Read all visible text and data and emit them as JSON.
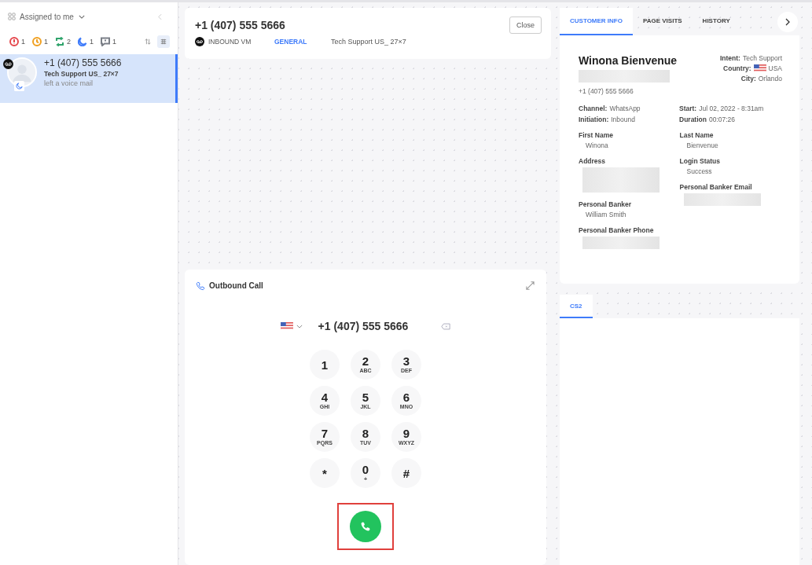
{
  "sidebar": {
    "filter_label": "Assigned to me",
    "status_counts": [
      {
        "kind": "alert",
        "count": "1",
        "color": "#e5484d"
      },
      {
        "kind": "pending",
        "count": "1",
        "color": "#f0a020"
      },
      {
        "kind": "transfer",
        "count": "2",
        "color": "#30a46c"
      },
      {
        "kind": "sleep",
        "count": "1",
        "color": "#3e7bfa"
      },
      {
        "kind": "message",
        "count": "1",
        "color": "#7a7f87"
      }
    ],
    "view_toggles": [
      {
        "kind": "sort",
        "selected": false
      },
      {
        "kind": "grid",
        "selected": true
      }
    ],
    "conversations": [
      {
        "phone": "+1 (407) 555 5666",
        "queue": "Tech Support US_ 27×7",
        "preview": "left a voice mail",
        "selected": true
      }
    ]
  },
  "conversation": {
    "phone": "+1 (407) 555 5666",
    "close_label": "Close",
    "channel": "INBOUND VM",
    "category": "GENERAL",
    "queue": "Tech Support US_ 27×7"
  },
  "dialer": {
    "title": "Outbound Call",
    "number": "+1 (407) 555 5666",
    "keys": [
      {
        "digit": "1"
      },
      {
        "digit": "2",
        "letters": "ABC"
      },
      {
        "digit": "3",
        "letters": "DEF"
      },
      {
        "digit": "4",
        "letters": "GHI"
      },
      {
        "digit": "5",
        "letters": "JKL"
      },
      {
        "digit": "6",
        "letters": "MNO"
      },
      {
        "digit": "7",
        "letters": "PQRS"
      },
      {
        "digit": "8",
        "letters": "TUV"
      },
      {
        "digit": "9",
        "letters": "WXYZ"
      },
      {
        "digit": "*"
      },
      {
        "digit": "0",
        "letters": "+"
      },
      {
        "digit": "#"
      }
    ],
    "call_button": {
      "highlighted": true
    }
  },
  "info_tabs": [
    {
      "label": "CUSTOMER INFO",
      "selected": true
    },
    {
      "label": "PAGE VISITS",
      "selected": false
    },
    {
      "label": "HISTORY",
      "selected": false
    }
  ],
  "customer": {
    "name": "Winona Bienvenue",
    "phone": "+1 (407) 555 5666",
    "summary_right": [
      {
        "label": "Intent:",
        "value": "Tech Support"
      },
      {
        "label": "Country:",
        "value": "USA",
        "flag": true
      },
      {
        "label": "City:",
        "value": "Orlando"
      }
    ],
    "meta_left": [
      {
        "label": "Channel:",
        "value": "WhatsApp"
      },
      {
        "label": "Initiation:",
        "value": "Inbound"
      }
    ],
    "meta_right": [
      {
        "label": "Start:",
        "value": "Jul 02, 2022 - 8:31am"
      },
      {
        "label": "Duration",
        "value": "00:07:26"
      }
    ],
    "fields_left": [
      {
        "label": "First Name",
        "value": "Winona"
      },
      {
        "label": "Address",
        "kind": "blurred_block"
      },
      {
        "label": "Personal Banker",
        "value": "William Smith"
      },
      {
        "label": "Personal Banker Phone",
        "kind": "blurred_line"
      }
    ],
    "fields_right": [
      {
        "label": "Last Name",
        "value": "Bienvenue"
      },
      {
        "label": "Login Status",
        "value": "Success"
      },
      {
        "label": "Personal Banker Email",
        "kind": "blurred_line"
      }
    ]
  },
  "lower_tabs": [
    {
      "label": "CS2",
      "selected": true
    }
  ]
}
